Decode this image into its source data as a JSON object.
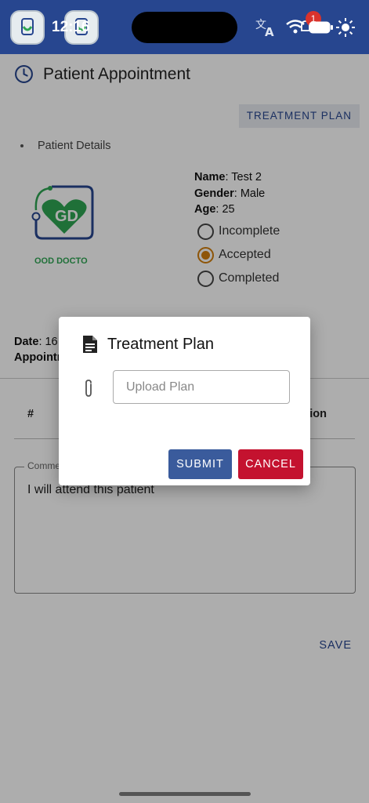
{
  "status_bar": {
    "time": "12:16",
    "notification_count": "1",
    "icons": [
      "app-thumb-icon",
      "translate-icon",
      "wifi-icon",
      "bell-icon",
      "battery-icon",
      "brightness-icon"
    ]
  },
  "header": {
    "title": "Patient Appointment",
    "icon": "clock-icon"
  },
  "actions": {
    "treatment_plan_label": "TREATMENT PLAN",
    "save_label": "SAVE"
  },
  "patient": {
    "section_label": "Patient Details",
    "logo_text": "OOD DOCTO",
    "name_label": "Name",
    "name_value": ": Test 2",
    "gender_label": "Gender",
    "gender_value": ": Male",
    "age_label": "Age",
    "age_value": ": 25",
    "statuses": [
      {
        "label": "Incomplete",
        "selected": false
      },
      {
        "label": "Accepted",
        "selected": true
      },
      {
        "label": "Completed",
        "selected": false
      }
    ]
  },
  "appointment": {
    "date_label": "Date",
    "date_value": ": 16",
    "appointment_label": "Appointn"
  },
  "table": {
    "col_hash": "#",
    "col_last": "ion"
  },
  "comment": {
    "label": "Comme",
    "text": "I will attend this patient"
  },
  "dialog": {
    "title": "Treatment Plan",
    "upload_placeholder": "Upload Plan",
    "submit_label": "SUBMIT",
    "cancel_label": "CANCEL"
  },
  "colors": {
    "primary": "#27468f",
    "accent": "#d17e0c",
    "danger": "#c4122f",
    "logo_green": "#2ea553"
  }
}
